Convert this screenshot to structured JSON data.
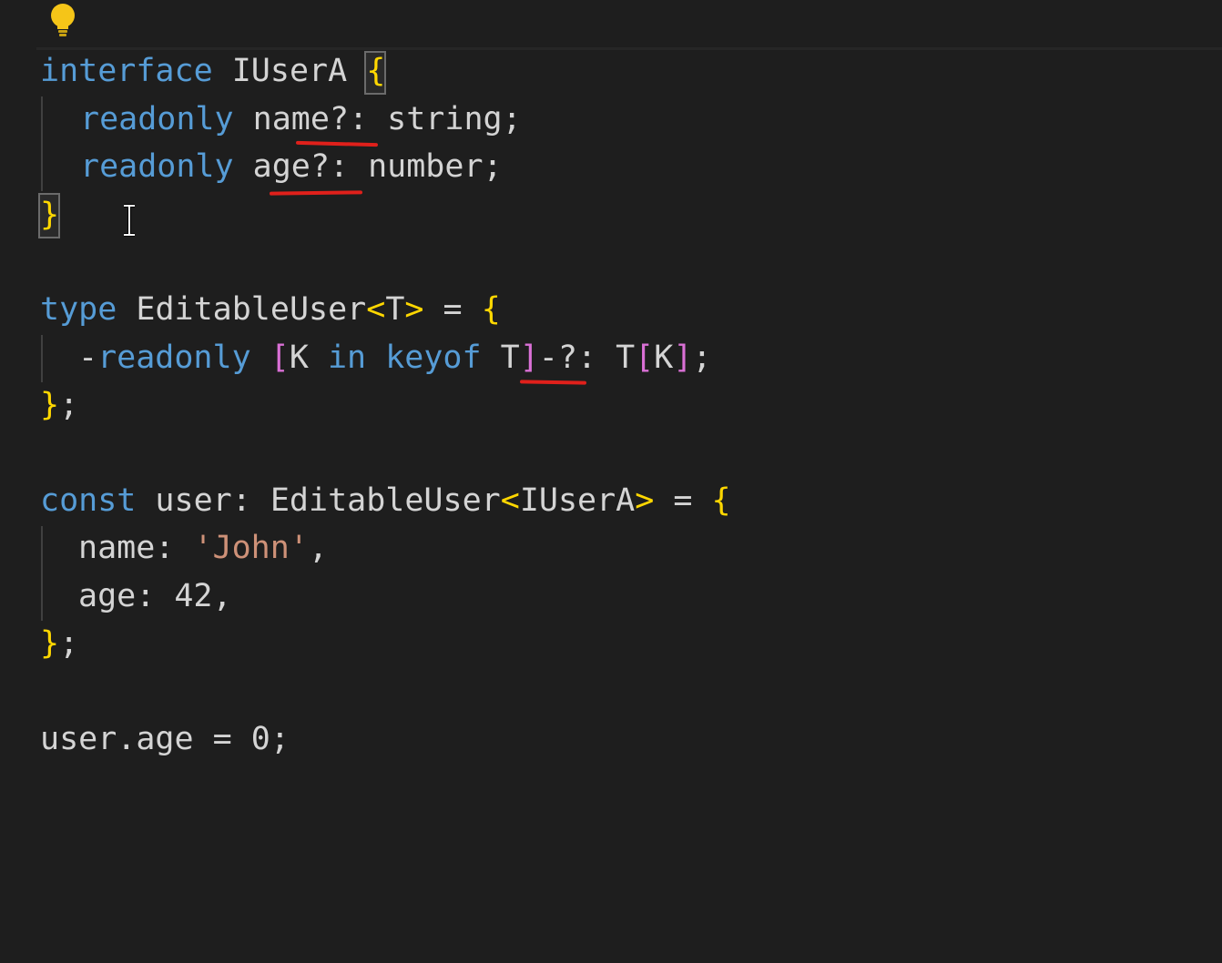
{
  "editor": {
    "lightbulb_icon": "lightbulb-icon",
    "cursor_icon": "text-cursor-icon",
    "colors": {
      "background": "#1e1e1e",
      "keyword": "#569cd6",
      "bracket": "#ffd700",
      "bracket_alt": "#da70d6",
      "string": "#ce9178",
      "underline": "#e0201b"
    },
    "lines": {
      "l1": {
        "kw": "interface",
        "name": " IUserA ",
        "brace": "{"
      },
      "l2": {
        "kw": "readonly",
        "rest": " name?: string;"
      },
      "l3": {
        "kw": "readonly",
        "rest": " age?: number;"
      },
      "l4": {
        "brace": "}"
      },
      "l5": {
        "kw": "type",
        "name": " EditableUser",
        "lt": "<",
        "t": "T",
        "gt": ">",
        "eq": " = ",
        "brace": "{"
      },
      "l6": {
        "minus": "-",
        "kw": "readonly",
        "sp": " ",
        "lb": "[",
        "k": "K ",
        "in": "in",
        "sp2": " ",
        "keyof": "keyof",
        "t": " T",
        "rb": "]",
        "opt": "-?: ",
        "tk": "T",
        "lb2": "[",
        "k2": "K",
        "rb2": "]",
        "semi": ";"
      },
      "l7": {
        "brace": "}",
        "semi": ";"
      },
      "l8": {
        "kw": "const",
        "name": " user: EditableUser",
        "lt": "<",
        "t": "IUserA",
        "gt": ">",
        "eq": " = ",
        "brace": "{"
      },
      "l9": {
        "key": "name: ",
        "str": "'John'",
        "comma": ","
      },
      "l10": {
        "key": "age: ",
        "num": "42",
        "comma": ","
      },
      "l11": {
        "brace": "}",
        "semi": ";"
      },
      "l12": {
        "text": "user.age = 0;"
      }
    }
  }
}
